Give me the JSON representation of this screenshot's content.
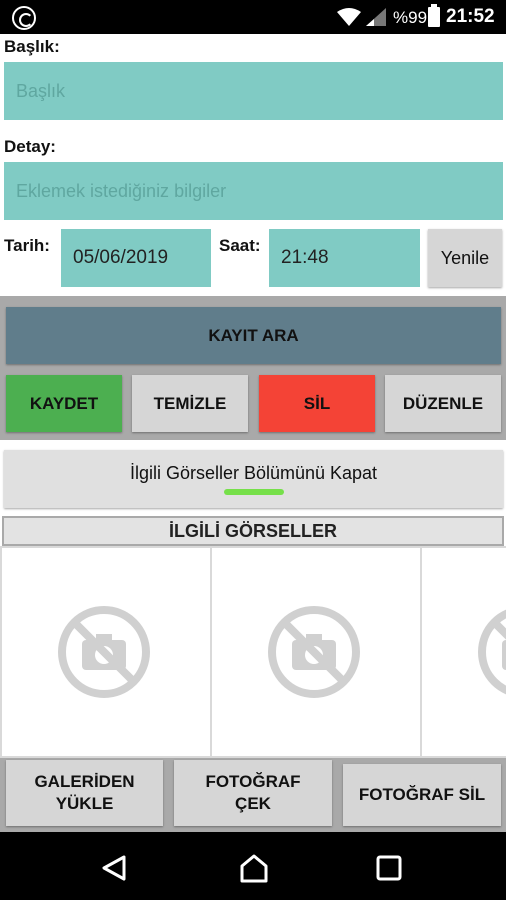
{
  "status_bar": {
    "battery": "%99",
    "time": "21:52"
  },
  "form": {
    "baslik_label": "Başlık:",
    "baslik_placeholder": "Başlık",
    "detay_label": "Detay:",
    "detay_placeholder": "Eklemek istediğiniz bilgiler",
    "tarih_label": "Tarih:",
    "tarih_value": "05/06/2019",
    "saat_label": "Saat:",
    "saat_value": "21:48",
    "yenile_label": "Yenile"
  },
  "actions": {
    "search": "KAYIT ARA",
    "save": "KAYDET",
    "clear": "TEMİZLE",
    "delete": "SİL",
    "edit": "DÜZENLE"
  },
  "toggle_images": "İlgili Görseller Bölümünü Kapat",
  "images_section": {
    "title": "İLGİLİ GÖRSELLER"
  },
  "photo_actions": {
    "gallery": "GALERİDEN YÜKLE",
    "take": "FOTOĞRAF ÇEK",
    "delete": "FOTOĞRAF SİL"
  },
  "colors": {
    "field": "#80cbc4",
    "search": "#607d8b",
    "save": "#4caf50",
    "delete": "#f44336",
    "toggle_indicator": "#76e04a"
  },
  "icons": [
    "refresh-app-icon",
    "wifi-icon",
    "signal-icon",
    "battery-charging-icon",
    "no-photo-icon",
    "back-icon",
    "home-icon",
    "recents-icon"
  ]
}
